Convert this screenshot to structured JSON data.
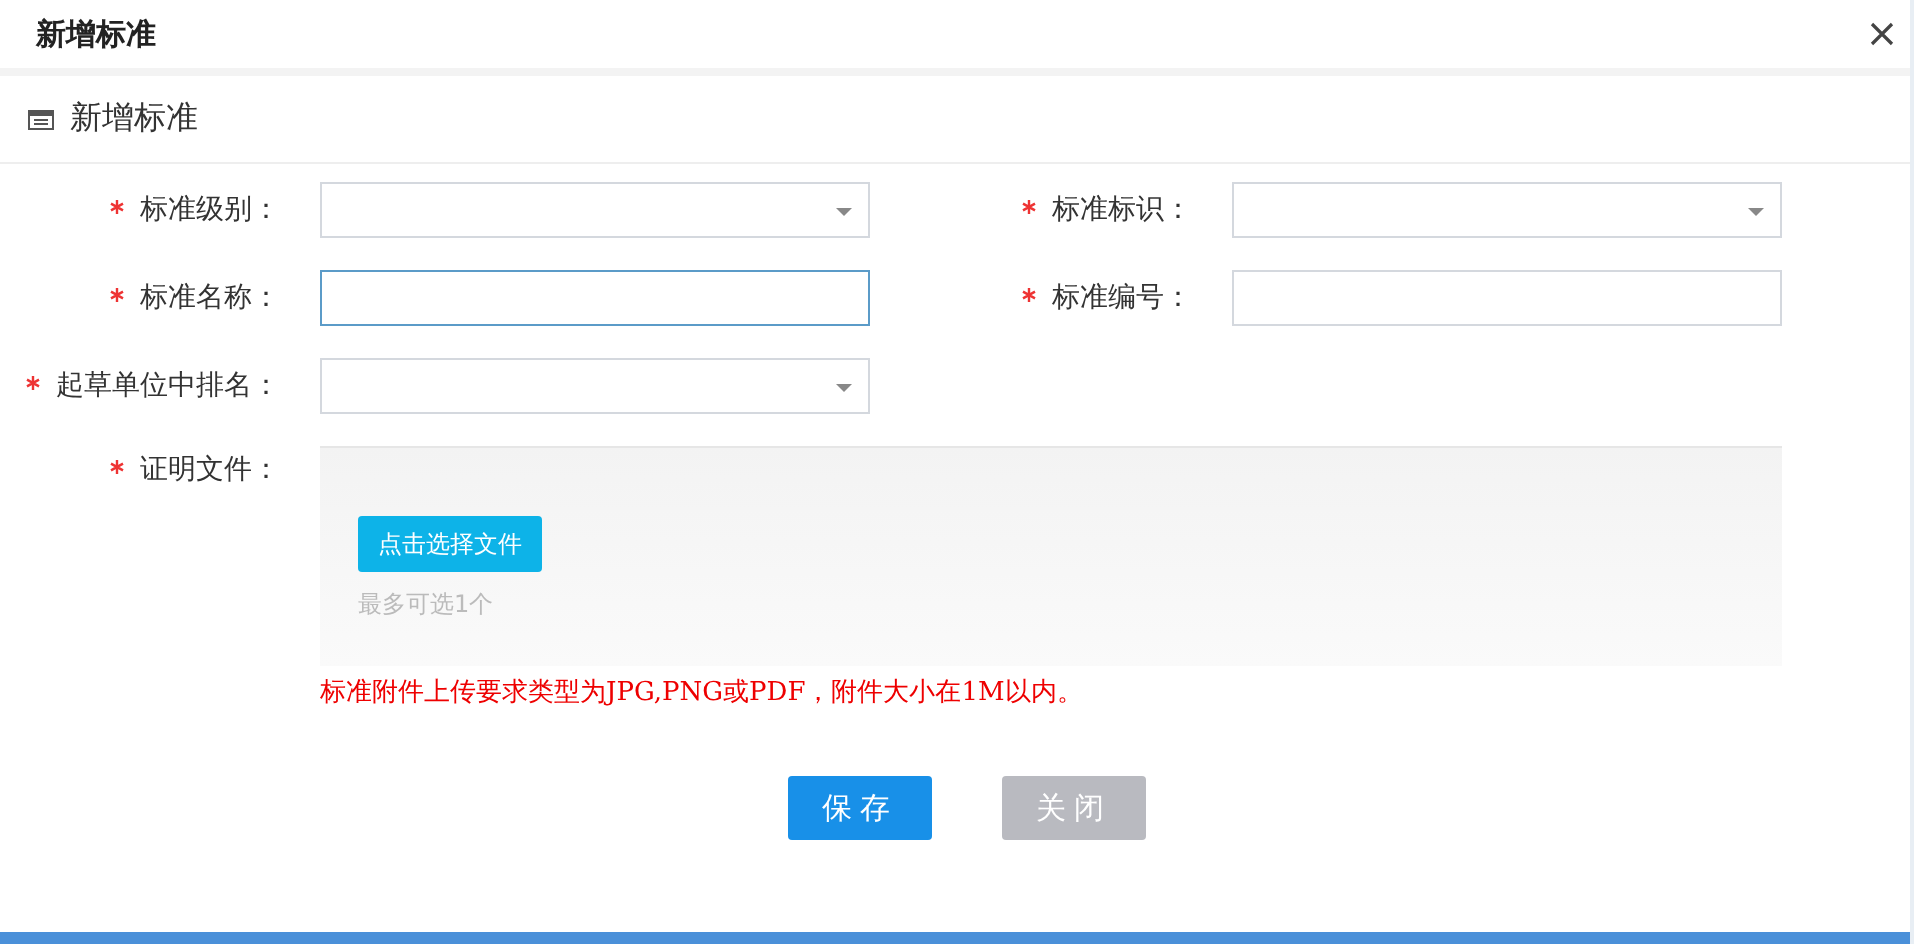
{
  "dialog": {
    "title": "新增标准"
  },
  "section": {
    "title": "新增标准"
  },
  "fields": [
    {
      "label": "标准级别：",
      "required": true,
      "kind": "select",
      "focused": false
    },
    {
      "label": "标准标识：",
      "required": true,
      "kind": "select",
      "focused": false
    },
    {
      "label": "标准名称：",
      "required": true,
      "kind": "text",
      "focused": true
    },
    {
      "label": "标准编号：",
      "required": true,
      "kind": "text",
      "focused": false
    },
    {
      "label": "起草单位中排名：",
      "required": true,
      "kind": "select",
      "focused": false
    }
  ],
  "upload": {
    "label": "证明文件：",
    "required": true,
    "button": "点击选择文件",
    "hint": "最多可选1个",
    "note": "标准附件上传要求类型为JPG,PNG或PDF，附件大小在1M以内。"
  },
  "buttons": [
    {
      "label": "保存",
      "kind": "primary"
    },
    {
      "label": "关闭",
      "kind": "secondary"
    }
  ]
}
